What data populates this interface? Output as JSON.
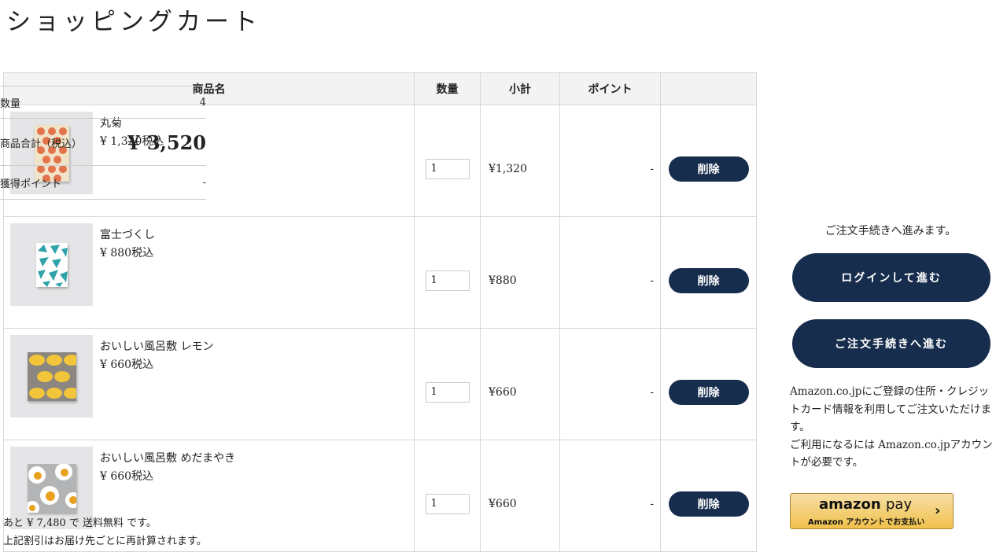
{
  "page": {
    "title": "ショッピングカート"
  },
  "table": {
    "headers": {
      "name": "商品名",
      "qty": "数量",
      "subtotal": "小計",
      "points": "ポイント"
    },
    "items": [
      {
        "name": "丸菊",
        "price": "¥ 1,320税込",
        "qty": "1",
        "subtotal": "¥1,320",
        "points": "-",
        "delete_label": "削除",
        "thumbnail_icon": "maru-kiku-furoshiki-image"
      },
      {
        "name": "富士づくし",
        "price": "¥ 880税込",
        "qty": "1",
        "subtotal": "¥880",
        "points": "-",
        "delete_label": "削除",
        "thumbnail_icon": "fuji-zukushi-furoshiki-image"
      },
      {
        "name": "おいしい風呂敷 レモン",
        "price": "¥ 660税込",
        "qty": "1",
        "subtotal": "¥660",
        "points": "-",
        "delete_label": "削除",
        "thumbnail_icon": "lemon-furoshiki-image"
      },
      {
        "name": "おいしい風呂敷 めだまやき",
        "price": "¥ 660税込",
        "qty": "1",
        "subtotal": "¥660",
        "points": "-",
        "delete_label": "削除",
        "thumbnail_icon": "medamayaki-furoshiki-image"
      }
    ]
  },
  "notes": {
    "shipping": "あと ¥ 7,480 で 送料無料 です。",
    "discount": "上記割引はお届け先ごとに再計算されます。"
  },
  "summary": {
    "qty_label": "数量",
    "qty_value": "4",
    "total_label": "商品合計（税込）",
    "total_value": "¥ 3,520",
    "points_label": "獲得ポイント",
    "points_value": "-"
  },
  "checkout": {
    "proceed_text": "ご注文手続きへ進みます。",
    "login_button": "ログインして進む",
    "order_button": "ご注文手続きへ進む",
    "amazon_desc_1": "Amazon.co.jpにご登録の住所・クレジットカード情報を利用してご注文いただけます。",
    "amazon_desc_2": "ご利用になるには Amazon.co.jpアカウントが必要です。",
    "amazon_pay": {
      "logo_amazon": "amazon",
      "logo_pay": "pay",
      "subtext": "Amazon アカウントでお支払い",
      "chevron": "›"
    }
  },
  "colors": {
    "primary": "#172d4d",
    "amazon_button": "#f0c14b"
  }
}
